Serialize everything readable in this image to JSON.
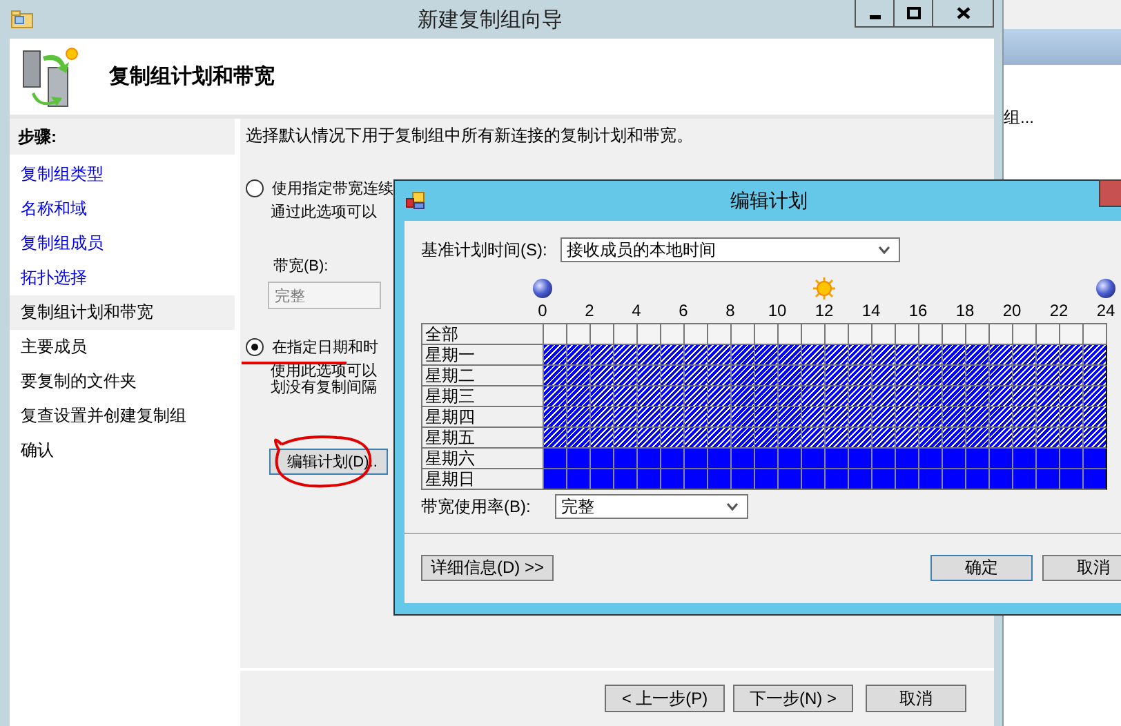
{
  "window": {
    "title": "新建复制组向导"
  },
  "header": {
    "title": "复制组计划和带宽"
  },
  "steps": {
    "heading": "步骤:",
    "items": [
      {
        "label": "复制组类型",
        "completed": true,
        "selected": false
      },
      {
        "label": "名称和域",
        "completed": true,
        "selected": false
      },
      {
        "label": "复制组成员",
        "completed": true,
        "selected": false
      },
      {
        "label": "拓扑选择",
        "completed": true,
        "selected": false
      },
      {
        "label": "复制组计划和带宽",
        "completed": false,
        "selected": true
      },
      {
        "label": "主要成员",
        "completed": false,
        "selected": false
      },
      {
        "label": "要复制的文件夹",
        "completed": false,
        "selected": false
      },
      {
        "label": "复查设置并创建复制组",
        "completed": false,
        "selected": false
      },
      {
        "label": "确认",
        "completed": false,
        "selected": false
      }
    ]
  },
  "content": {
    "intro": "选择默认情况下用于复制组中所有新连接的复制计划和带宽。",
    "options": [
      {
        "label": "使用指定带宽连续",
        "selected": false,
        "description": [
          "通过此选项可以"
        ]
      },
      {
        "label": "在指定日期和时",
        "selected": true,
        "description": [
          "使用此选项可以",
          "划没有复制间隔"
        ]
      }
    ],
    "bandwidth": {
      "label": "带宽(B):",
      "value": "完整",
      "disabled": true
    },
    "edit_button": "编辑计划(D).."
  },
  "buttons": [
    "< 上一步(P)",
    "下一步(N) >",
    "取消"
  ],
  "background_window": {
    "text": "组..."
  },
  "dialog": {
    "title": "编辑计划",
    "base_time": {
      "label": "基准计划时间(S):",
      "value": "接收成员的本地时间"
    },
    "hours": [
      "0",
      "2",
      "4",
      "6",
      "8",
      "10",
      "12",
      "14",
      "16",
      "18",
      "20",
      "22",
      "24"
    ],
    "all_label": "全部",
    "days": [
      {
        "label": "星期一",
        "selected": true
      },
      {
        "label": "星期二",
        "selected": true
      },
      {
        "label": "星期三",
        "selected": true
      },
      {
        "label": "星期四",
        "selected": true
      },
      {
        "label": "星期五",
        "selected": true
      },
      {
        "label": "星期六",
        "selected": false
      },
      {
        "label": "星期日",
        "selected": false
      }
    ],
    "bandwidth_usage": {
      "label": "带宽使用率(B):",
      "value": "完整"
    },
    "details_button": "详细信息(D) >>",
    "ok_button": "确定",
    "cancel_button": "取消"
  }
}
